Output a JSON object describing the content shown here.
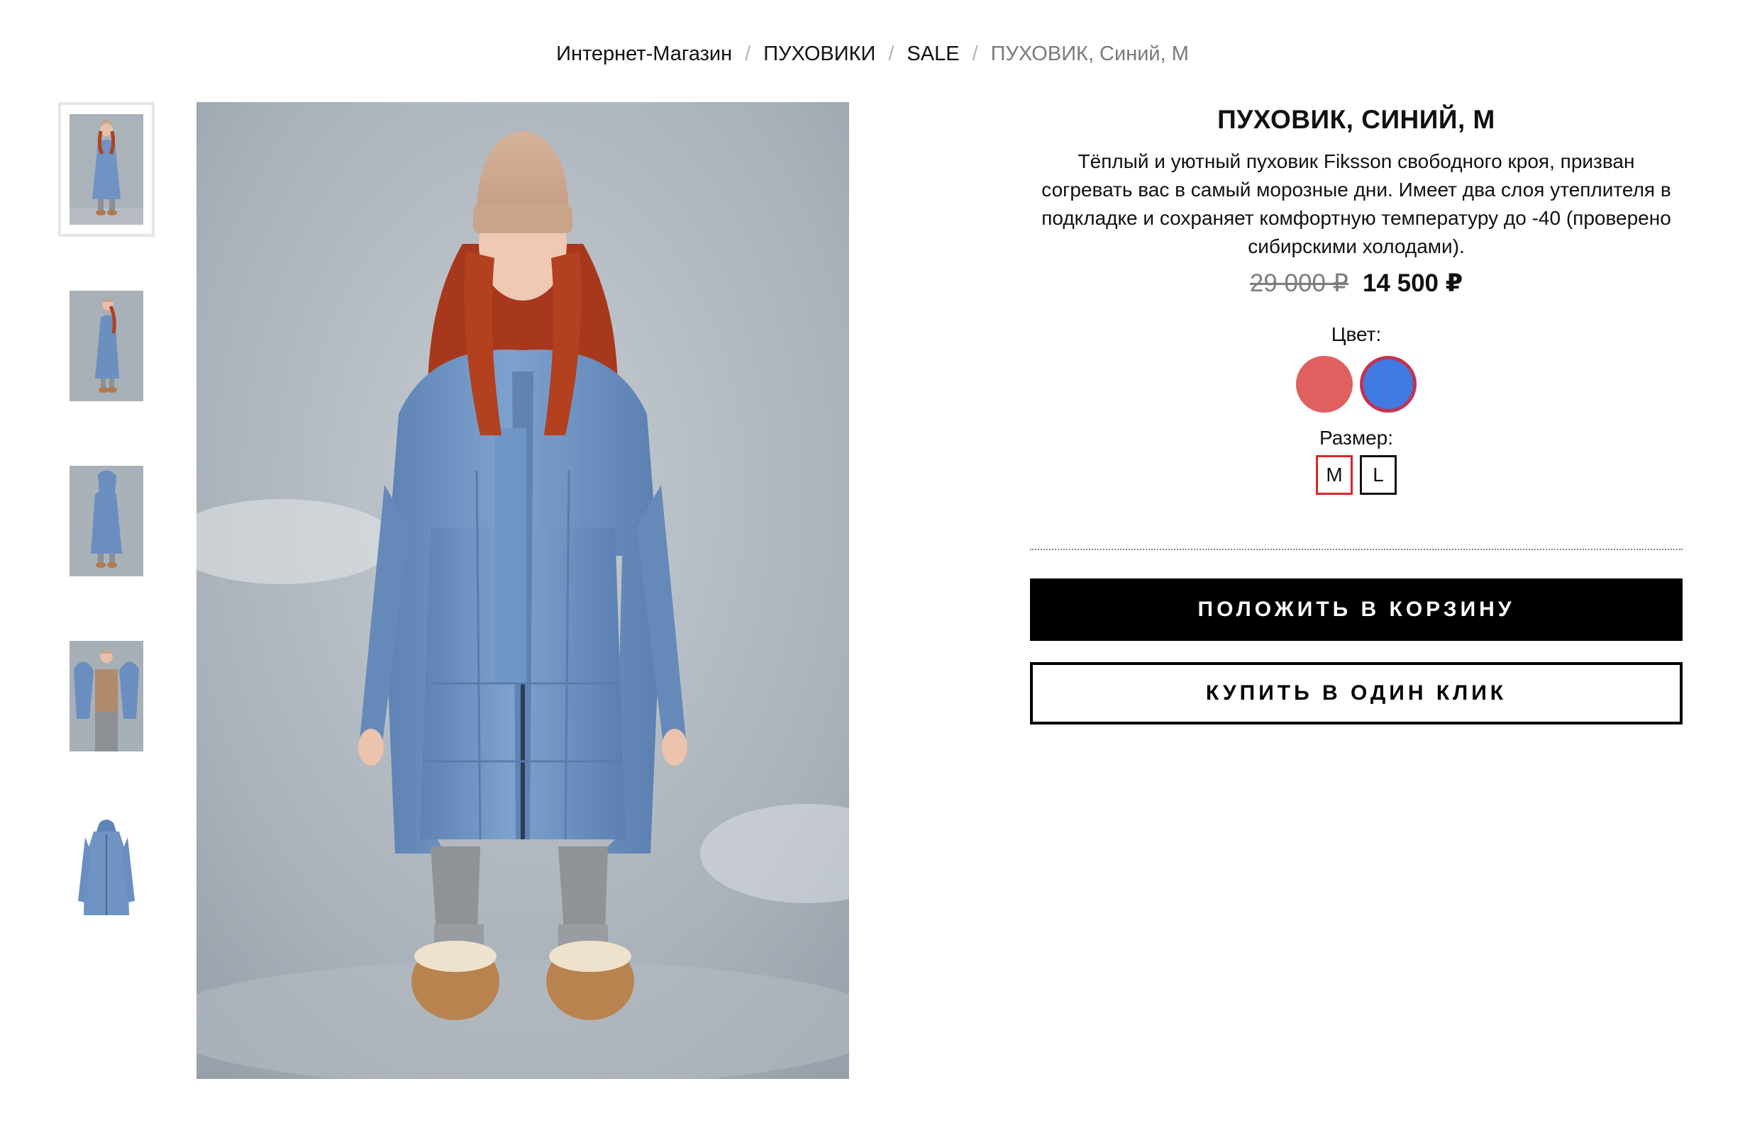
{
  "breadcrumb": {
    "items": [
      "Интернет-Магазин",
      "ПУХОВИКИ",
      "SALE",
      "ПУХОВИК, Синий, M"
    ],
    "separator": "/"
  },
  "gallery": {
    "thumbnails": [
      "model-front",
      "model-side",
      "model-back",
      "model-open-coat",
      "coat-flat-lay"
    ],
    "active_index": 0
  },
  "product": {
    "title": "ПУХОВИК, СИНИЙ, M",
    "description": "Тёплый и уютный пуховик Fiksson свободного кроя, призван согревать вас в самый морозные дни. Имеет два слоя утеплителя в подкладке и сохраняет комфортную температуру до -40 (проверено сибирскими холодами).",
    "old_price": "29 000 ₽",
    "price": "14 500 ₽",
    "color_label": "Цвет:",
    "colors": [
      {
        "hex": "#e06060",
        "selected": false
      },
      {
        "hex": "#3f7be3",
        "selected": true,
        "ring": "#c03454"
      }
    ],
    "size_label": "Размер:",
    "sizes": [
      "M",
      "L"
    ],
    "selected_size": "M",
    "selected_color_ring": "#d8272c",
    "add_to_cart": "ПОЛОЖИТЬ В КОРЗИНУ",
    "buy_one_click": "КУПИТЬ В ОДИН КЛИК"
  }
}
